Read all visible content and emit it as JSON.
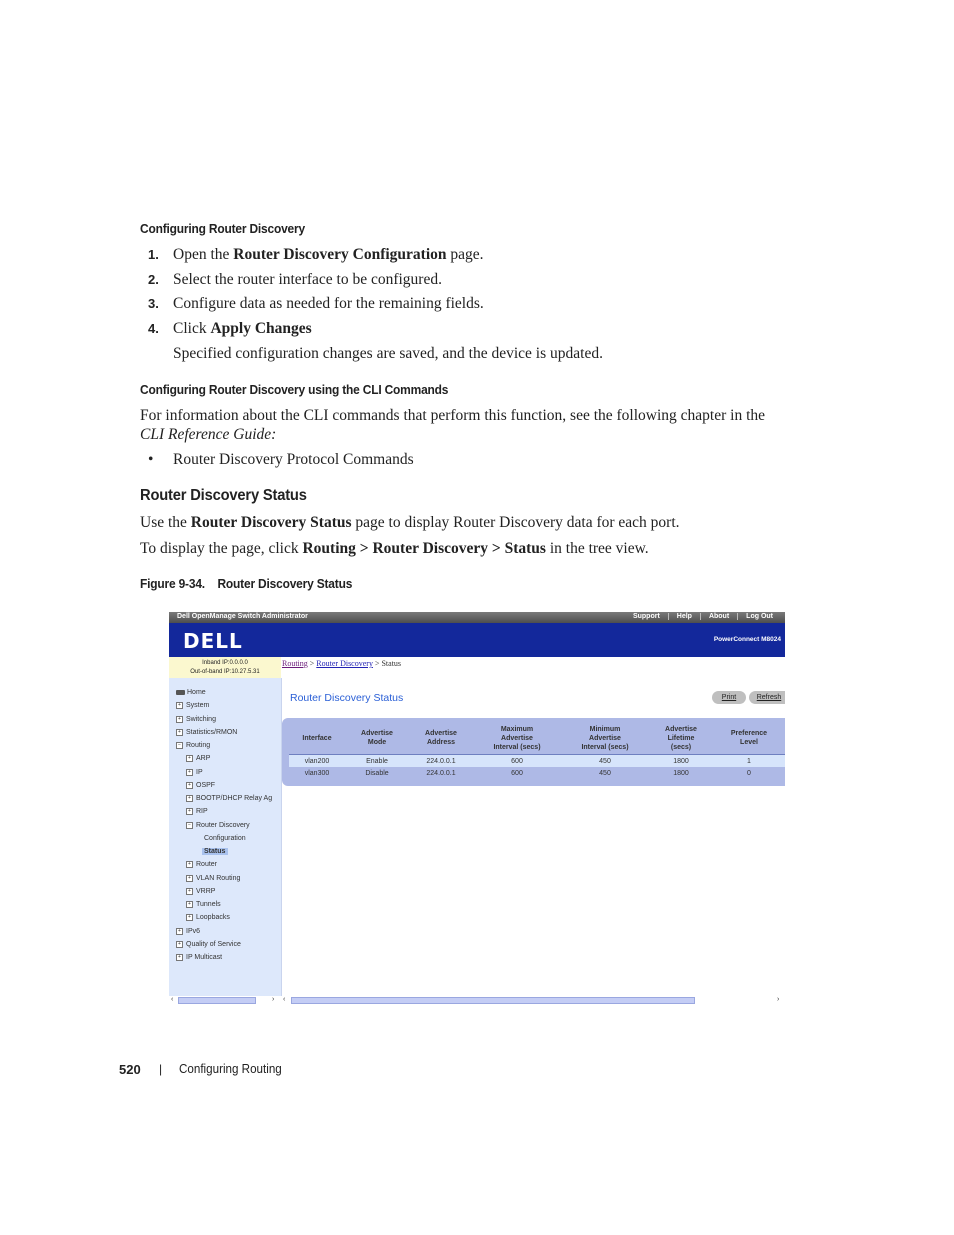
{
  "doc": {
    "section1_heading": "Configuring Router Discovery",
    "steps": [
      {
        "num": "1.",
        "pre": "Open the ",
        "bold": "Router Discovery Configuration",
        "post": " page."
      },
      {
        "num": "2.",
        "pre": "Select the router interface to be configured.",
        "bold": "",
        "post": ""
      },
      {
        "num": "3.",
        "pre": "Configure data as needed for the remaining fields.",
        "bold": "",
        "post": ""
      },
      {
        "num": "4.",
        "pre": "Click ",
        "bold": "Apply Changes",
        "post": ""
      }
    ],
    "step4_note": "Specified configuration changes are saved, and the device is updated.",
    "section2_heading": "Configuring Router Discovery using the CLI Commands",
    "cli_para": "For information about the CLI commands that perform this function, see the following chapter in the",
    "cli_guide": "CLI Reference Guide:",
    "bullet": "Router Discovery Protocol Commands",
    "section3_heading": "Router Discovery Status",
    "para1_pre": "Use the ",
    "para1_bold": "Router Discovery Status",
    "para1_post": " page to display Router Discovery data for each port.",
    "para2_pre": "To display the page, click ",
    "para2_b1": "Routing",
    "para2_sep1": " > ",
    "para2_b2": "Router Discovery",
    "para2_sep2": " > ",
    "para2_b3": "Status",
    "para2_post": " in the tree view.",
    "figure_caption": "Figure 9-34.    Router Discovery Status",
    "footer_page": "520",
    "footer_sep": "|",
    "footer_chapter": "Configuring Routing"
  },
  "app": {
    "window_title": "Dell OpenManage Switch Administrator",
    "top_links": [
      "Support",
      "Help",
      "About",
      "Log Out"
    ],
    "logo": "DELL",
    "product": "PowerConnect M8024",
    "inband_ip": "Inband IP:0.0.0.0",
    "oob_ip": "Out-of-band IP:10.27.5.31",
    "breadcrumb": {
      "l1": "Routing",
      "sep": " > ",
      "l2": "Router Discovery",
      "current": "Status"
    },
    "page_title": "Router Discovery Status",
    "buttons": {
      "print": "Print",
      "refresh": "Refresh"
    },
    "tree": [
      {
        "label": "Home",
        "level": 0,
        "icon": "home-icon"
      },
      {
        "label": "System",
        "level": 0,
        "icon": "expand-icon"
      },
      {
        "label": "Switching",
        "level": 0,
        "icon": "expand-icon"
      },
      {
        "label": "Statistics/RMON",
        "level": 0,
        "icon": "expand-icon"
      },
      {
        "label": "Routing",
        "level": 0,
        "icon": "collapse-icon"
      },
      {
        "label": "ARP",
        "level": 1,
        "icon": "expand-icon"
      },
      {
        "label": "IP",
        "level": 1,
        "icon": "expand-icon"
      },
      {
        "label": "OSPF",
        "level": 1,
        "icon": "expand-icon"
      },
      {
        "label": "BOOTP/DHCP Relay Ag",
        "level": 1,
        "icon": "expand-icon"
      },
      {
        "label": "RIP",
        "level": 1,
        "icon": "expand-icon"
      },
      {
        "label": "Router Discovery",
        "level": 1,
        "icon": "collapse-icon"
      },
      {
        "label": "Configuration",
        "level": 2,
        "icon": ""
      },
      {
        "label": "Status",
        "level": 2,
        "icon": "",
        "selected": true
      },
      {
        "label": "Router",
        "level": 1,
        "icon": "expand-icon"
      },
      {
        "label": "VLAN Routing",
        "level": 1,
        "icon": "expand-icon"
      },
      {
        "label": "VRRP",
        "level": 1,
        "icon": "expand-icon"
      },
      {
        "label": "Tunnels",
        "level": 1,
        "icon": "expand-icon"
      },
      {
        "label": "Loopbacks",
        "level": 1,
        "icon": "expand-icon"
      },
      {
        "label": "IPv6",
        "level": 0,
        "icon": "expand-icon"
      },
      {
        "label": "Quality of Service",
        "level": 0,
        "icon": "expand-icon"
      },
      {
        "label": "IP Multicast",
        "level": 0,
        "icon": "expand-icon"
      }
    ],
    "table": {
      "headers": [
        [
          "Interface"
        ],
        [
          "Advertise",
          "Mode"
        ],
        [
          "Advertise",
          "Address"
        ],
        [
          "Maximum",
          "Advertise",
          "Interval (secs)"
        ],
        [
          "Minimum",
          "Advertise",
          "Interval (secs)"
        ],
        [
          "Advertise",
          "Lifetime",
          "(secs)"
        ],
        [
          "Preference",
          "Level"
        ]
      ],
      "rows": [
        [
          "vlan200",
          "Enable",
          "224.0.0.1",
          "600",
          "450",
          "1800",
          "1"
        ],
        [
          "vlan300",
          "Disable",
          "224.0.0.1",
          "600",
          "450",
          "1800",
          "0"
        ]
      ]
    }
  }
}
